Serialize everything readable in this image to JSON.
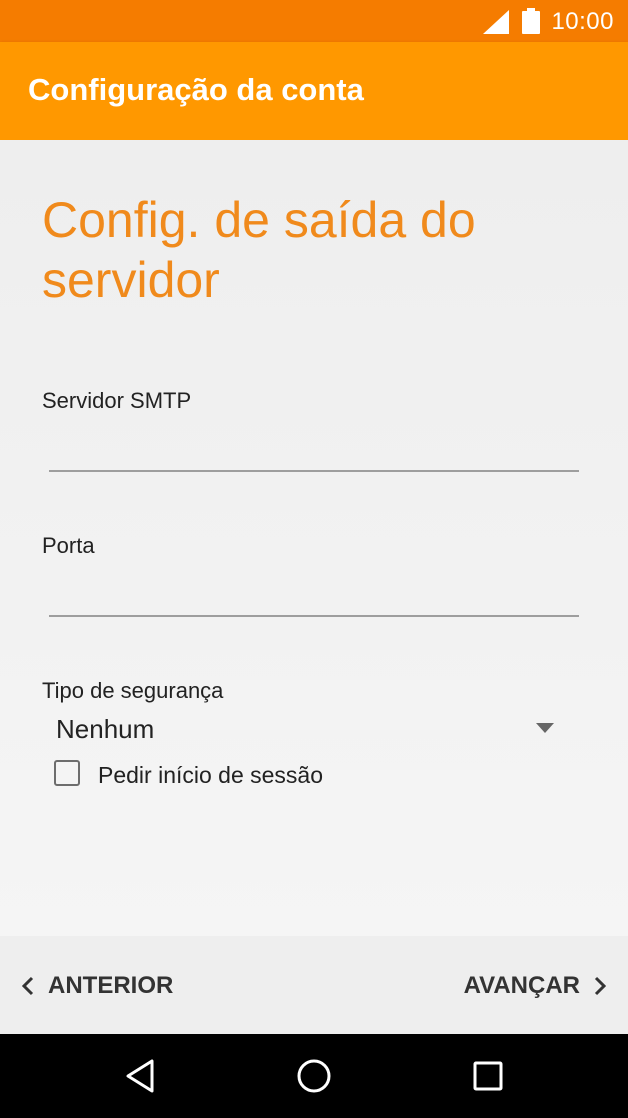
{
  "status_bar": {
    "time": "10:00",
    "signal_icon": "signal-icon",
    "battery_icon": "battery-icon"
  },
  "app_bar": {
    "title": "Configuração da conta"
  },
  "heading": "Config. de saída do servidor",
  "fields": {
    "smtp": {
      "label": "Servidor SMTP",
      "value": ""
    },
    "port": {
      "label": "Porta",
      "value": ""
    }
  },
  "security": {
    "label": "Tipo de segurança",
    "selected": "Nenhum",
    "arrow_icon": "dropdown-arrow-icon"
  },
  "require_signin": {
    "label": "Pedir início de sessão",
    "checked": false
  },
  "footer": {
    "prev_label": "ANTERIOR",
    "next_label": "AVANÇAR"
  },
  "nav": {
    "back": "back-icon",
    "home": "home-icon",
    "recents": "recents-icon"
  },
  "colors": {
    "status_bar": "#f57c00",
    "app_bar": "#ff9800",
    "heading": "#f08a1c"
  }
}
